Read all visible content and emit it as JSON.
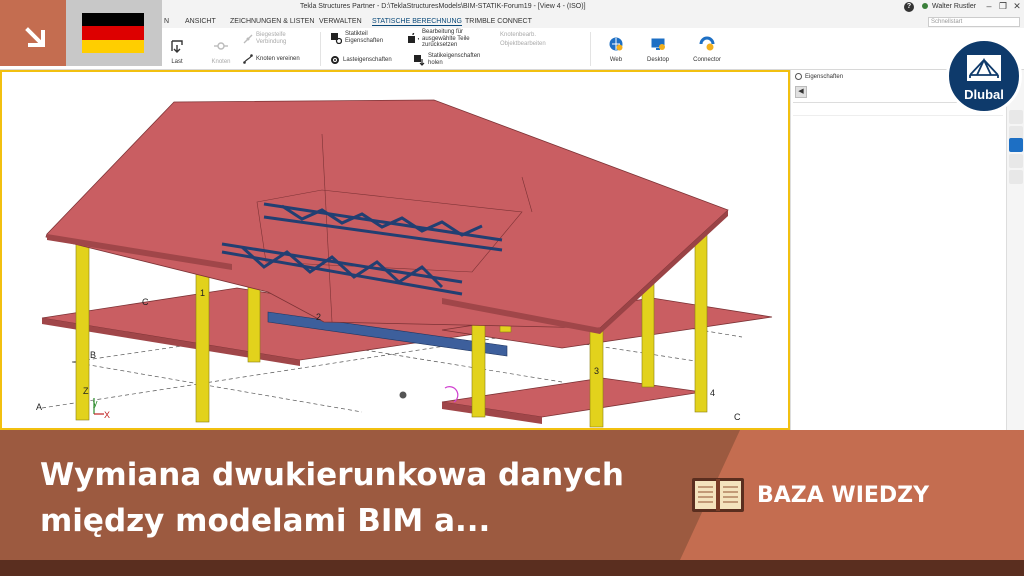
{
  "window": {
    "title": "Tekla Structures Partner - D:\\TeklaStructuresModels\\BIM-STATIK-Forum19 - [View 4 - (ISO)]",
    "user": "Walter Rustler",
    "search_placeholder": "Schnellstart"
  },
  "tabs": [
    {
      "label": "ANSICHT"
    },
    {
      "label": "ZEICHNUNGEN & LISTEN"
    },
    {
      "label": "VERWALTEN"
    },
    {
      "label": "STATISCHE BERECHNUNG",
      "active": true
    },
    {
      "label": "TRIMBLE CONNECT"
    }
  ],
  "tab_partial": "N",
  "ribbon": {
    "last": "Last",
    "knoten": "Knoten",
    "biegesteife": "Biegesteife Verbindung",
    "knoten_vereinen": "Knoten vereinen",
    "statikteil": "Statikteil Eigenschaften",
    "lasteigenschaften": "Lasteigenschaften",
    "bearbeitung": "Bearbeitung für ausgewählte Teile zurücksetzen",
    "statikeigenschaften": "Statikeigenschaften holen",
    "knotenbearbeiten": "Knotenbearb.",
    "objektbearbeiten": "Objektbearbeiten",
    "web": "Web",
    "desktop": "Desktop",
    "connector": "Connector"
  },
  "properties_panel": {
    "title": "Eigenschaften",
    "back": "◀"
  },
  "model_labels": {
    "grid_a": "A",
    "grid_b": "B",
    "grid_c_left": "C",
    "grid_c_right": "C",
    "axis_1": "1",
    "axis_2": "2",
    "axis_3": "3",
    "axis_4": "4",
    "coord_z": "Z",
    "coord_y": "y",
    "coord_x": "X"
  },
  "banner": {
    "headline_line1": "Wymiana dwukierunkowa danych",
    "headline_line2": "między modelami BIM a...",
    "category": "BAZA WIEDZY"
  },
  "brand": {
    "logo_text": "Dlubal"
  },
  "colors": {
    "slab": "#c95e62",
    "column": "#e2d21c",
    "truss": "#2d4f8a",
    "banner_dark": "#9c5a40",
    "banner_accent": "#c46d50",
    "selection_border": "#f2c010",
    "brand_blue": "#0e3a6b"
  }
}
